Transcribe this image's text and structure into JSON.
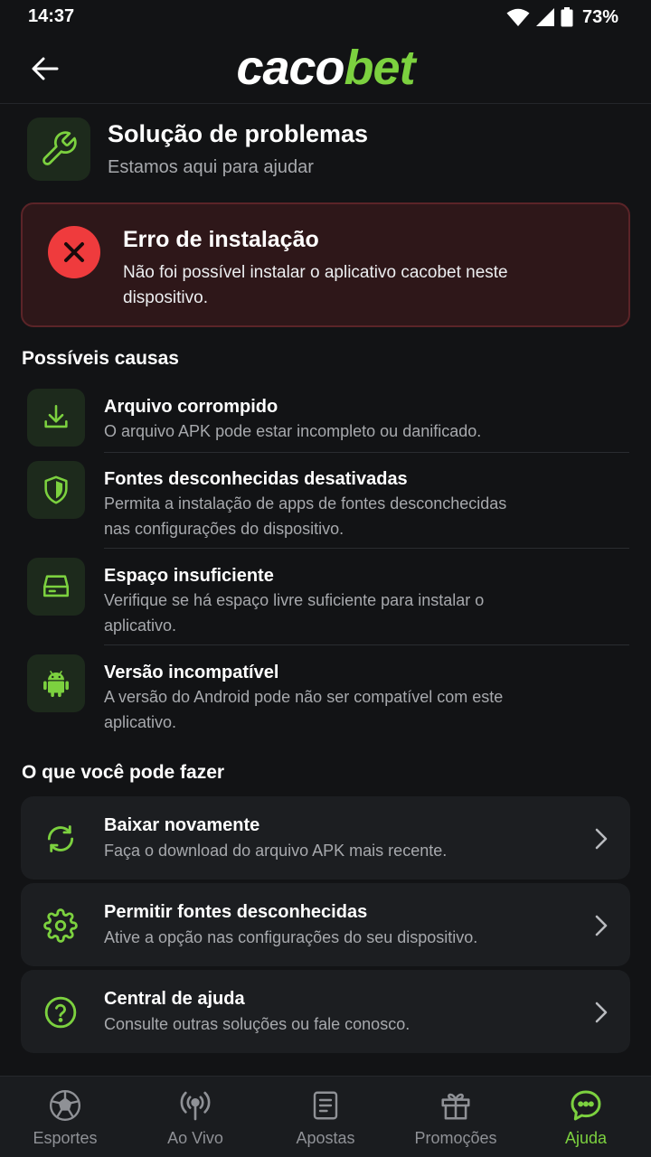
{
  "status_bar": {
    "time": "14:37",
    "battery": "73%"
  },
  "header": {
    "logo_part1": "caco",
    "logo_part2": "bet"
  },
  "page": {
    "title": "Solução de problemas",
    "subtitle": "Estamos aqui para ajudar"
  },
  "error": {
    "title": "Erro de instalação",
    "message": "Não foi possível instalar o aplicativo cacobet neste dispositivo."
  },
  "causes": {
    "title": "Possíveis causas",
    "items": [
      {
        "title": "Arquivo corrompido",
        "desc": "O arquivo APK pode estar incompleto ou danificado.",
        "icon": "download-icon"
      },
      {
        "title": "Fontes desconhecidas desativadas",
        "desc": "Permita a instalação de apps de fontes desconchecidas nas configurações do dispositivo.",
        "icon": "shield-icon"
      },
      {
        "title": "Espaço insuficiente",
        "desc": "Verifique se há espaço livre suficiente para instalar o aplicativo.",
        "icon": "storage-icon"
      },
      {
        "title": "Versão incompatível",
        "desc": "A versão do Android pode não ser compatível com este aplicativo.",
        "icon": "android-icon"
      }
    ]
  },
  "actions": {
    "title": "O que você pode fazer",
    "items": [
      {
        "title": "Baixar novamente",
        "desc": "Faça o download do arquivo APK mais recente.",
        "icon": "refresh-icon"
      },
      {
        "title": "Permitir fontes desconhecidas",
        "desc": "Ative a opção nas configurações do seu dispositivo.",
        "icon": "gear-icon"
      },
      {
        "title": "Central de ajuda",
        "desc": "Consulte outras soluções ou fale conosco.",
        "icon": "help-icon"
      }
    ]
  },
  "nav": {
    "items": [
      {
        "label": "Esportes",
        "icon": "soccer-ball-icon"
      },
      {
        "label": "Ao Vivo",
        "icon": "live-broadcast-icon"
      },
      {
        "label": "Apostas",
        "icon": "bet-slip-icon"
      },
      {
        "label": "Promoções",
        "icon": "gift-icon"
      },
      {
        "label": "Ajuda",
        "icon": "chat-icon",
        "active": true
      }
    ]
  },
  "colors": {
    "accent": "#7cd13f",
    "background": "#121315",
    "error": "#ef3b3d",
    "error_card_bg": "#2e1719"
  }
}
